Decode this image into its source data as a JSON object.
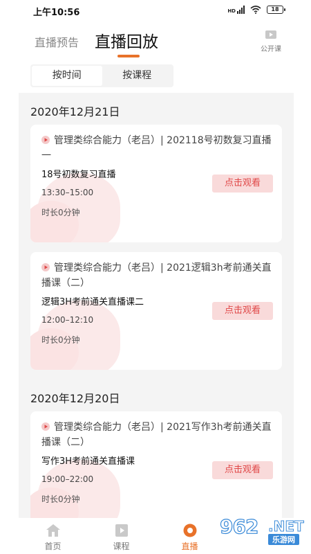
{
  "status_bar": {
    "time": "上午10:56",
    "network": "HD",
    "battery": "18"
  },
  "header": {
    "tab_preview": "直播预告",
    "tab_replay": "直播回放",
    "public_course": "公开课"
  },
  "segment": {
    "by_time": "按时间",
    "by_course": "按课程"
  },
  "groups": [
    {
      "date": "2020年12月21日",
      "cards": [
        {
          "title": "管理类综合能力（老吕）| 202118号初数复习直播一",
          "subtitle": "18号初数复习直播",
          "time": "13:30–15:00",
          "duration": "时长0分钟",
          "action": "点击观看"
        },
        {
          "title": "管理类综合能力（老吕）| 2021逻辑3h考前通关直播课（二）",
          "subtitle": "逻辑3H考前通关直播课二",
          "time": "12:00–12:10",
          "duration": "时长0分钟",
          "action": "点击观看"
        }
      ]
    },
    {
      "date": "2020年12月20日",
      "cards": [
        {
          "title": "管理类综合能力（老吕）| 2021写作3h考前通关直播课（二）",
          "subtitle": "写作3H考前通关直播课",
          "time": "19:00–22:00",
          "duration": "时长0分钟",
          "action": "点击观看"
        }
      ]
    }
  ],
  "bottom_nav": [
    {
      "label": "首页",
      "icon": "home-icon"
    },
    {
      "label": "课程",
      "icon": "course-icon"
    },
    {
      "label": "直播",
      "icon": "live-icon"
    }
  ],
  "watermark": {
    "digits": "962",
    "net": ".NET",
    "sub": "乐游网"
  },
  "colors": {
    "accent": "#e8722a",
    "watch_button_bg": "#f9dada",
    "watch_button_text": "#e04848",
    "content_bg": "#f4f4f4"
  }
}
